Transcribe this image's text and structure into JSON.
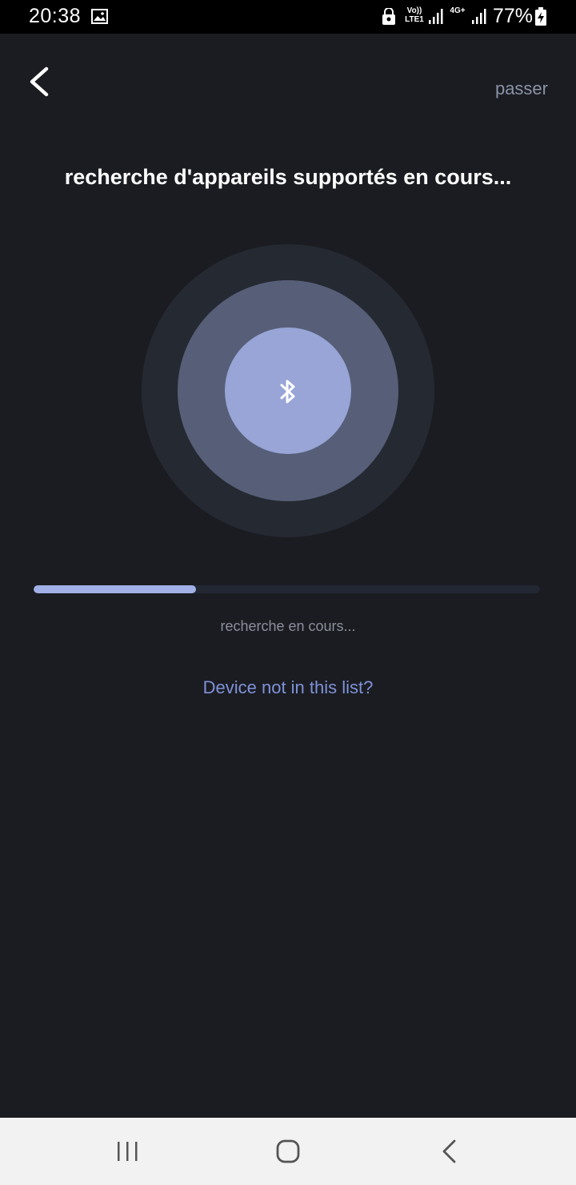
{
  "status_bar": {
    "time": "20:38",
    "volte_label": "Vo)) LTE1",
    "network_label": "4G+",
    "battery": "77%",
    "icons": [
      "image-icon",
      "lock-icon",
      "signal-icon",
      "battery-icon"
    ]
  },
  "header": {
    "back_icon": "chevron-left-icon",
    "skip_label": "passer"
  },
  "main": {
    "title": "recherche d'appareils supportés en cours...",
    "scan_icon": "bluetooth-icon",
    "progress_percent": 32,
    "progress_label": "recherche en cours...",
    "help_link": "Device not in this list?"
  },
  "nav_bar": {
    "buttons": [
      "recents-icon",
      "home-icon",
      "back-icon"
    ]
  },
  "colors": {
    "background": "#1a1c21",
    "accent": "#a1b0e6",
    "link": "#7f92d8",
    "muted_text": "#8a93a6"
  }
}
